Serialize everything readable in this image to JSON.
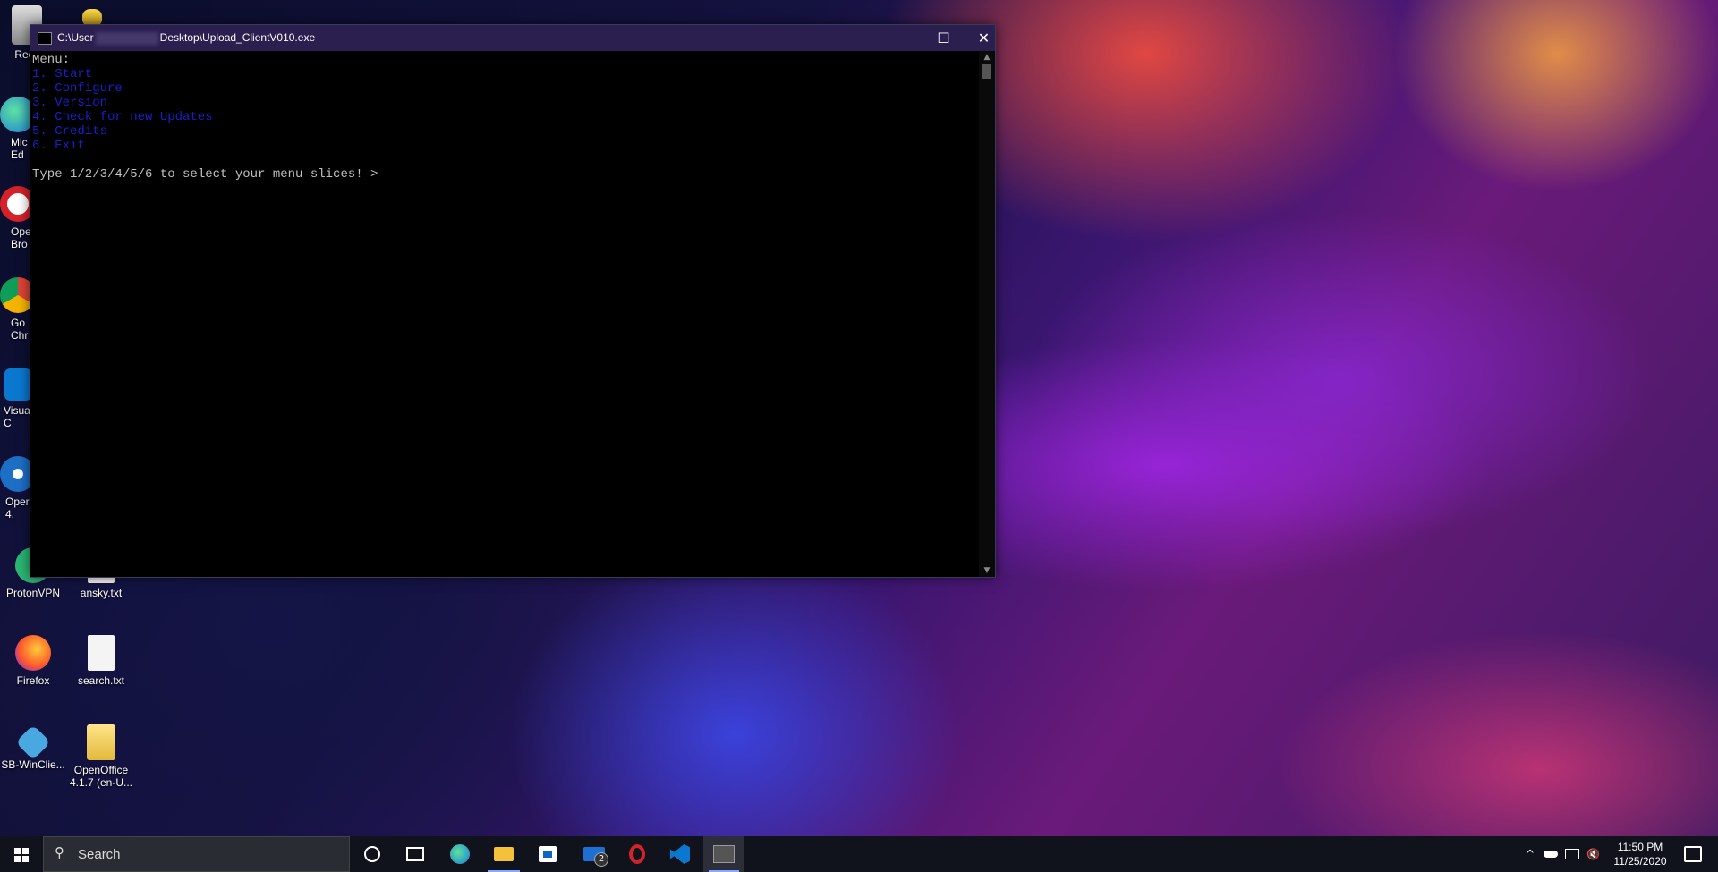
{
  "desktop": {
    "icons": [
      {
        "label": "Recy"
      },
      {
        "label": "Mic Ed"
      },
      {
        "label": "Ope Bro"
      },
      {
        "label": "Go Chr"
      },
      {
        "label": "Visua C"
      },
      {
        "label": "Oper 4."
      },
      {
        "label": "ProtonVPN"
      },
      {
        "label": "ansky.txt"
      },
      {
        "label": "Firefox"
      },
      {
        "label": "search.txt"
      },
      {
        "label": "SB-WinClie..."
      },
      {
        "label": "OpenOffice 4.1.7 (en-U..."
      }
    ]
  },
  "console": {
    "title_prefix": "C:\\User",
    "title_suffix": "Desktop\\Upload_ClientV010.exe",
    "minimize": "—",
    "maximize": "☐",
    "close": "✕",
    "header": "Menu:",
    "menu_items": [
      "1. Start",
      "2. Configure",
      "3. Version",
      "4. Check for new Updates",
      "5. Credits",
      "6. Exit"
    ],
    "prompt": "Type 1/2/3/4/5/6 to select your menu slices! >"
  },
  "taskbar": {
    "search_label": "Search",
    "mail_badge": "2",
    "clock_time": "11:50 PM",
    "clock_date": "11/25/2020"
  },
  "colors": {
    "console_bg": "#000000",
    "menu_text": "#1820c8",
    "titlebar": "#2b1f4f",
    "taskbar": "#10131c"
  }
}
